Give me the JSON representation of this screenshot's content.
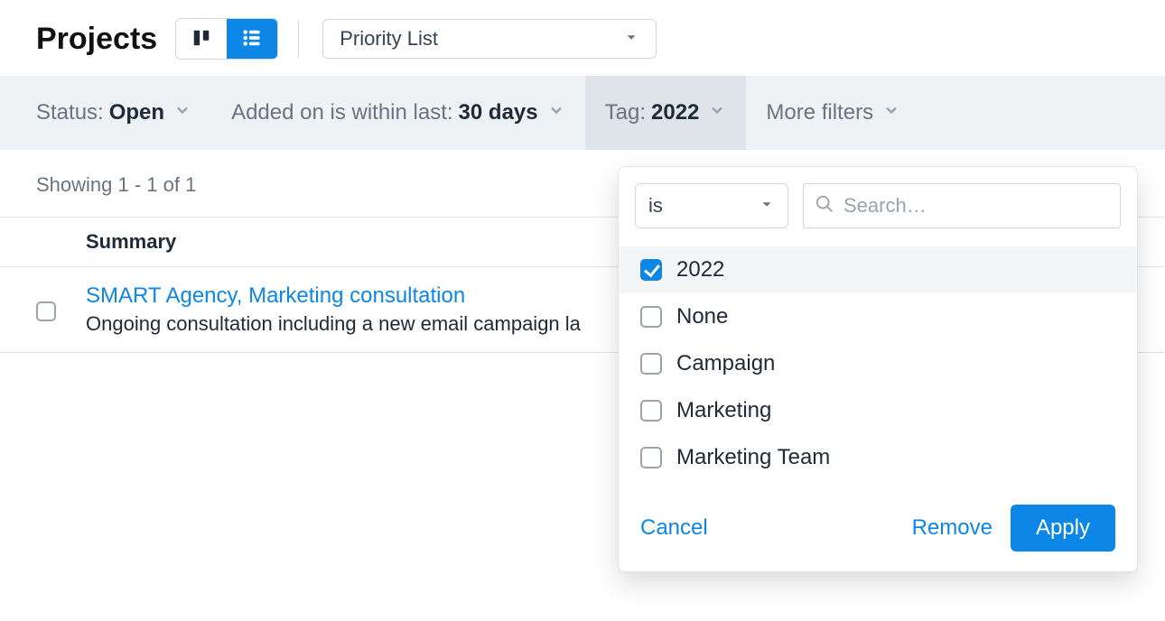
{
  "page_title": "Projects",
  "list_selector": {
    "selected": "Priority List"
  },
  "filters": {
    "status": {
      "label": "Status:",
      "value": "Open"
    },
    "added": {
      "label": "Added on is within last:",
      "value": "30 days"
    },
    "tag": {
      "label": "Tag:",
      "value": "2022"
    },
    "more": {
      "label": "More filters"
    }
  },
  "results_meta": "Showing 1 - 1 of 1",
  "columns": {
    "summary": "Summary"
  },
  "rows": [
    {
      "title": "SMART Agency, Marketing consultation",
      "desc": "Ongoing consultation including a new email campaign la"
    }
  ],
  "tag_dropdown": {
    "operator": "is",
    "search_placeholder": "Search…",
    "options": [
      {
        "label": "2022",
        "checked": true
      },
      {
        "label": "None",
        "checked": false
      },
      {
        "label": "Campaign",
        "checked": false
      },
      {
        "label": "Marketing",
        "checked": false
      },
      {
        "label": "Marketing Team",
        "checked": false
      }
    ],
    "cancel": "Cancel",
    "remove": "Remove",
    "apply": "Apply"
  },
  "colors": {
    "accent": "#0c87e8"
  }
}
